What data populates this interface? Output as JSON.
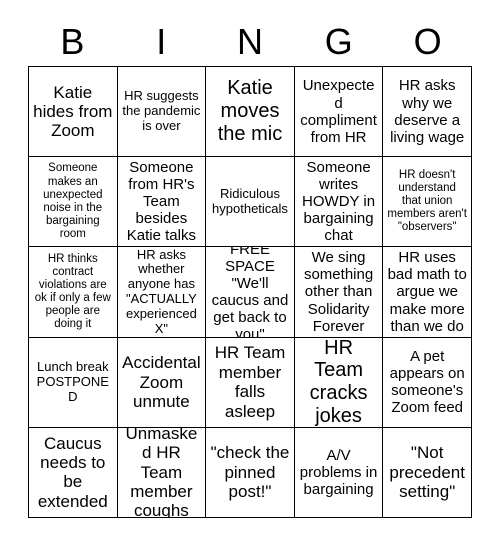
{
  "header": {
    "letters": [
      "B",
      "I",
      "N",
      "G",
      "O"
    ]
  },
  "grid": {
    "rows": [
      {
        "cells": [
          {
            "text": "Katie hides from Zoom",
            "size": "lg"
          },
          {
            "text": "HR suggests the pandemic is over",
            "size": "sm"
          },
          {
            "text": "Katie moves the mic",
            "size": "xl"
          },
          {
            "text": "Unexpected compliment from HR",
            "size": "md"
          },
          {
            "text": "HR asks why we deserve a living wage",
            "size": "md"
          }
        ]
      },
      {
        "cells": [
          {
            "text": "Someone makes an unexpected noise in the bargaining room",
            "size": "xs"
          },
          {
            "text": "Someone from HR's Team besides Katie talks",
            "size": "md"
          },
          {
            "text": "Ridiculous hypotheticals",
            "size": "sm"
          },
          {
            "text": "Someone writes HOWDY in bargaining chat",
            "size": "md"
          },
          {
            "text": "HR doesn't understand that union members aren't \"observers\"",
            "size": "xs"
          }
        ]
      },
      {
        "cells": [
          {
            "text": "HR thinks contract violations are ok if only a few people are doing it",
            "size": "xs"
          },
          {
            "text": "HR asks whether anyone has \"ACTUALLY experienced X\"",
            "size": "sm"
          },
          {
            "text": "FREE SPACE \"We'll caucus and get back to you\"",
            "size": "md"
          },
          {
            "text": "We sing something other than Solidarity Forever",
            "size": "md"
          },
          {
            "text": "HR uses bad math to argue we make more than we do",
            "size": "md"
          }
        ]
      },
      {
        "cells": [
          {
            "text": "Lunch break POSTPONED",
            "size": "sm"
          },
          {
            "text": "Accidental Zoom unmute",
            "size": "lg"
          },
          {
            "text": "HR Team member falls asleep",
            "size": "lg"
          },
          {
            "text": "HR Team cracks jokes",
            "size": "xl"
          },
          {
            "text": "A pet appears on someone's Zoom feed",
            "size": "md"
          }
        ]
      },
      {
        "cells": [
          {
            "text": "Caucus needs to be extended",
            "size": "lg"
          },
          {
            "text": "Unmasked HR Team member coughs",
            "size": "lg"
          },
          {
            "text": "\"check the pinned post!\"",
            "size": "lg"
          },
          {
            "text": "A/V problems in bargaining",
            "size": "md"
          },
          {
            "text": "\"Not precedent setting\"",
            "size": "lg"
          }
        ]
      }
    ]
  },
  "colors": {
    "background": "#ffffff",
    "text": "#000000",
    "border": "#000000"
  }
}
